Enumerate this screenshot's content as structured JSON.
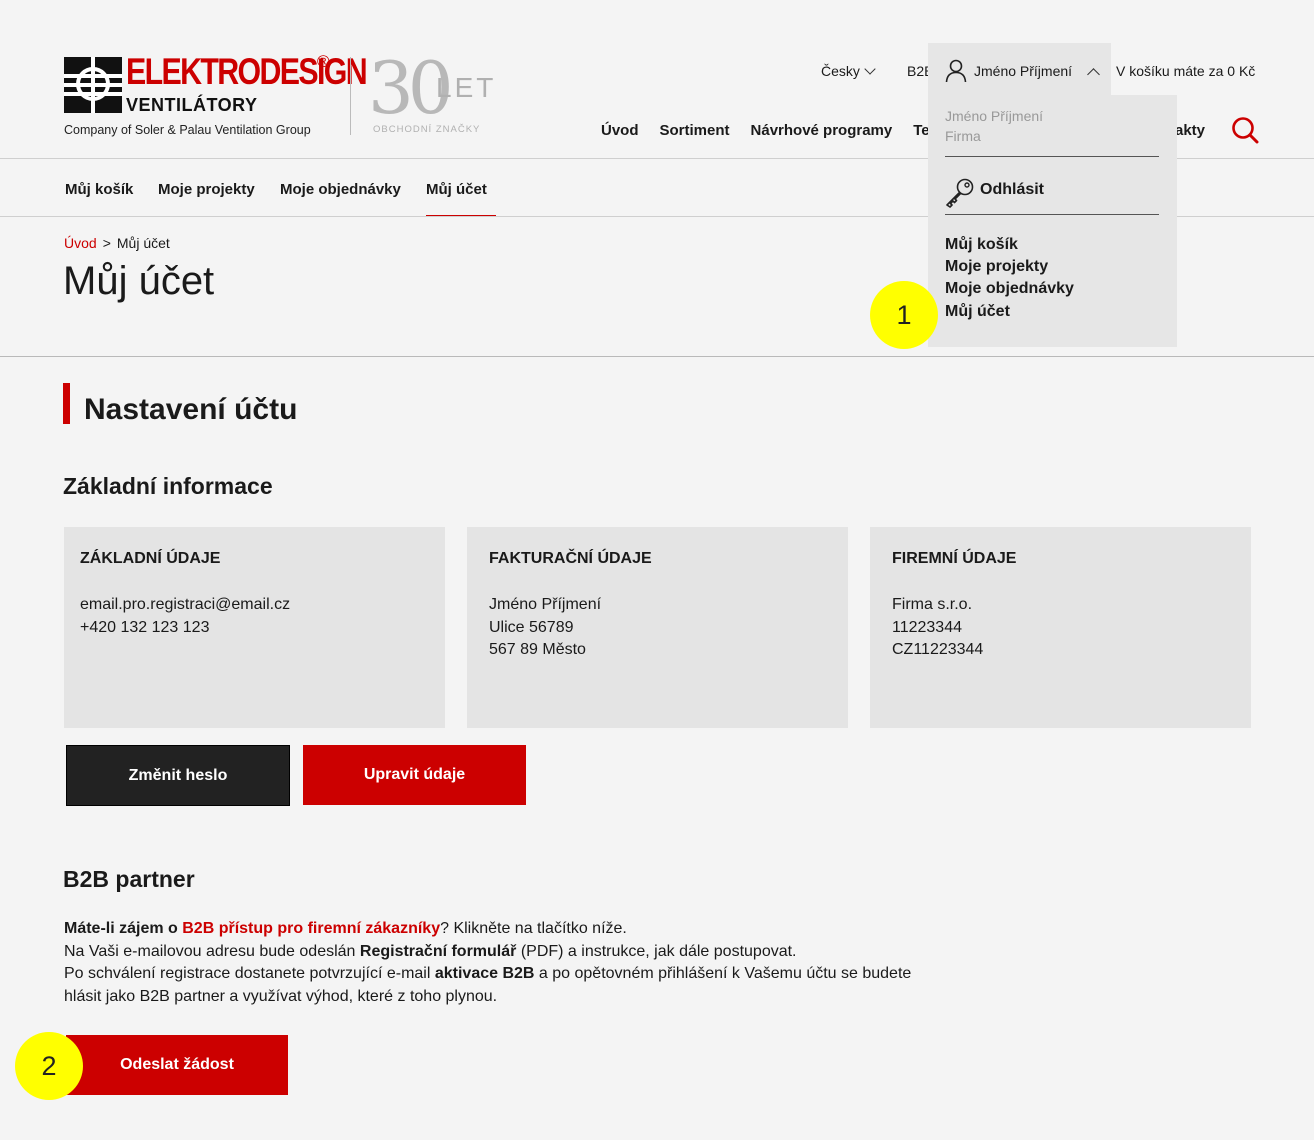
{
  "header": {
    "logo": {
      "name": "ELEKTRODESIGN",
      "registered": "®",
      "sub": "VENTILÁTORY",
      "tagline": "Company of Soler & Palau Ventilation Group"
    },
    "anniversary": {
      "number": "30",
      "let": "LET",
      "sub": "OBCHODNÍ ZNAČKY"
    },
    "language": "Česky",
    "b2b": "B2B",
    "cart": "V košíku máte za 0 Kč",
    "nav": [
      "Úvod",
      "Sortiment",
      "Návrhové programy",
      "Te"
    ],
    "nav_contacts": "akty"
  },
  "user_menu": {
    "tab_name": "Jméno Příjmení",
    "name": "Jméno Příjmení",
    "company": "Firma",
    "logout": "Odhlásit",
    "items": [
      "Můj košík",
      "Moje projekty",
      "Moje objednávky",
      "Můj účet"
    ]
  },
  "subnav": [
    "Můj košík",
    "Moje projekty",
    "Moje objednávky",
    "Můj účet"
  ],
  "breadcrumb": {
    "home": "Úvod",
    "separator": ">",
    "current": "Můj účet"
  },
  "page_title": "Můj účet",
  "section_title": "Nastavení účtu",
  "basic_info_title": "Základní informace",
  "cards": [
    {
      "title": "ZÁKLADNÍ ÚDAJE",
      "lines": [
        "email.pro.registraci@email.cz",
        "+420 132 123 123"
      ]
    },
    {
      "title": "FAKTURAČNÍ ÚDAJE",
      "lines": [
        "Jméno Příjmení",
        "Ulice 56789",
        "567 89 Město"
      ]
    },
    {
      "title": "FIREMNÍ ÚDAJE",
      "lines": [
        "Firma s.r.o.",
        "11223344",
        "CZ11223344"
      ]
    }
  ],
  "buttons": {
    "change_password": "Změnit heslo",
    "edit": "Upravit údaje",
    "send": "Odeslat žádost"
  },
  "b2b": {
    "title": "B2B partner",
    "p1_bold": "Máte-li zájem o ",
    "p1_link": "B2B přístup pro firemní zákazníky",
    "p1_rest": "? Klikněte na tlačítko níže.",
    "p2_a": "Na Vaši e-mailovou adresu bude odeslán ",
    "p2_bold": "Registrační formulář",
    "p2_b": " (PDF) a instrukce, jak dále postupovat.",
    "p3_a": "Po schválení registrace dostanete potvrzující e-mail ",
    "p3_bold": "aktivace B2B",
    "p3_b": " a po opětovném přihlášení k Vašemu účtu se budete",
    "p4": "hlásit jako B2B partner a využívat výhod, které z toho plynou."
  },
  "markers": [
    "1",
    "2"
  ],
  "colors": {
    "accent": "#cc0000",
    "dark_button": "#222222",
    "marker": "#ffff00"
  }
}
